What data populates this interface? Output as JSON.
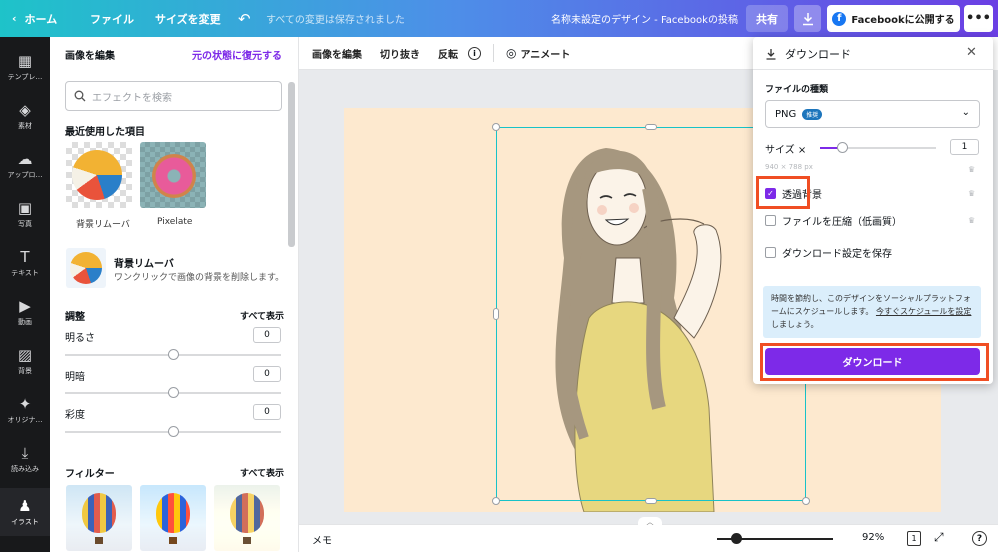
{
  "topbar": {
    "home_label": "ホーム",
    "file_label": "ファイル",
    "resize_label": "サイズを変更",
    "saved_status": "すべての変更は保存されました",
    "design_title": "名称未設定のデザイン - Facebookの投稿",
    "share_label": "共有",
    "publish_label": "Facebookに公開する"
  },
  "rail": {
    "items": [
      {
        "label": "テンプレ…",
        "icon": "template-icon"
      },
      {
        "label": "素材",
        "icon": "elements-icon"
      },
      {
        "label": "アップロ…",
        "icon": "upload-icon"
      },
      {
        "label": "写真",
        "icon": "photo-icon"
      },
      {
        "label": "テキスト",
        "icon": "text-icon"
      },
      {
        "label": "動画",
        "icon": "video-icon"
      },
      {
        "label": "背景",
        "icon": "background-icon"
      },
      {
        "label": "オリジナ…",
        "icon": "original-icon"
      },
      {
        "label": "読み込み",
        "icon": "import-icon"
      },
      {
        "label": "イラスト",
        "icon": "illust-icon"
      }
    ]
  },
  "panel": {
    "title": "画像を編集",
    "restore_label": "元の状態に復元する",
    "search_placeholder": "エフェクトを検索",
    "recent_title": "最近使用した項目",
    "recent": [
      {
        "label": "背景リムーバ"
      },
      {
        "label": "Pixelate"
      }
    ],
    "bg_remover": {
      "title": "背景リムーバ",
      "desc": "ワンクリックで画像の背景を削除します。"
    },
    "adjust": {
      "title": "調整",
      "show_all": "すべて表示",
      "items": [
        {
          "label": "明るさ",
          "value": "0"
        },
        {
          "label": "明暗",
          "value": "0"
        },
        {
          "label": "彩度",
          "value": "0"
        }
      ]
    },
    "filter": {
      "title": "フィルター",
      "show_all": "すべて表示"
    }
  },
  "toolbar": {
    "edit_image": "画像を編集",
    "crop": "切り抜き",
    "flip": "反転",
    "animate": "アニメート"
  },
  "download": {
    "title": "ダウンロード",
    "file_type_label": "ファイルの種類",
    "file_type_value": "PNG",
    "file_type_badge": "推奨",
    "size_label": "サイズ ×",
    "size_value": "1",
    "size_slider_fraction": 0.2,
    "dimensions": "940 × 788 px",
    "options": [
      {
        "label": "透過背景",
        "checked": true
      },
      {
        "label": "ファイルを圧縮（低画質）",
        "checked": false
      },
      {
        "label": "ダウンロード設定を保存",
        "checked": false
      }
    ],
    "info_text": "時間を節約し、このデザインをソーシャルプラットフォームにスケジュールします。",
    "info_link": "今すぐスケジュールを設定",
    "info_suffix": "しましょう。",
    "button_label": "ダウンロード"
  },
  "bottombar": {
    "memo_label": "メモ",
    "zoom_value": "92%",
    "page_count": "1",
    "help_label": "?"
  },
  "colors": {
    "accent": "#7d2ae8",
    "selection": "#18c2c8",
    "highlight": "#f04e23",
    "canvas_bg": "#fde9cf"
  }
}
